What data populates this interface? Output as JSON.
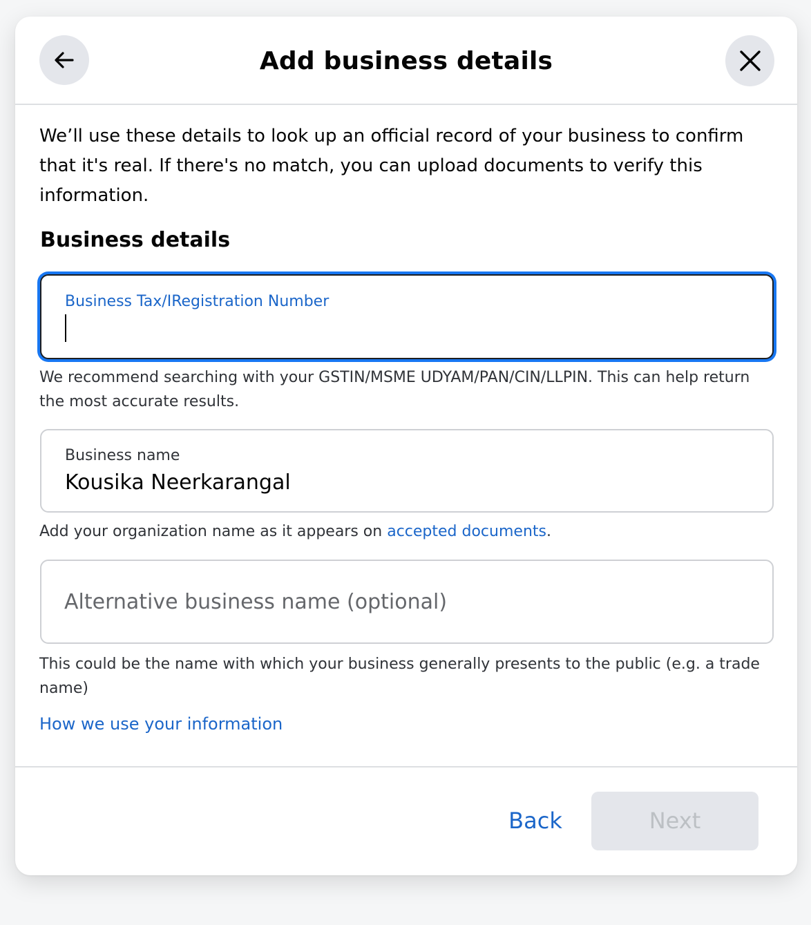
{
  "header": {
    "title": "Add business details",
    "back_icon": "arrow-left-icon",
    "close_icon": "close-icon"
  },
  "intro": "We’ll use these details to look up an official record of your business to confirm that it's real. If there's no match, you can upload documents to verify this information.",
  "section_title": "Business details",
  "fields": {
    "tax": {
      "label": "Business Tax/IRegistration Number",
      "value": "",
      "helper": "We recommend searching with your GSTIN/MSME UDYAM/PAN/CIN/LLPIN. This can help return the most accurate results."
    },
    "name": {
      "label": "Business name",
      "value": "Kousika Neerkarangal",
      "helper_prefix": "Add your organization name as it appears on ",
      "helper_link": "accepted documents",
      "helper_suffix": "."
    },
    "alt": {
      "placeholder": "Alternative business name (optional)",
      "value": "",
      "helper": "This could be the name with which your business generally presents to the public (e.g. a trade name)"
    }
  },
  "info_link": "How we use your information",
  "footer": {
    "back_label": "Back",
    "next_label": "Next"
  },
  "colors": {
    "accent": "#1b66c9",
    "focus_ring": "#1877f2",
    "disabled_bg": "#e4e6eb",
    "disabled_text": "#bcc0c4"
  }
}
